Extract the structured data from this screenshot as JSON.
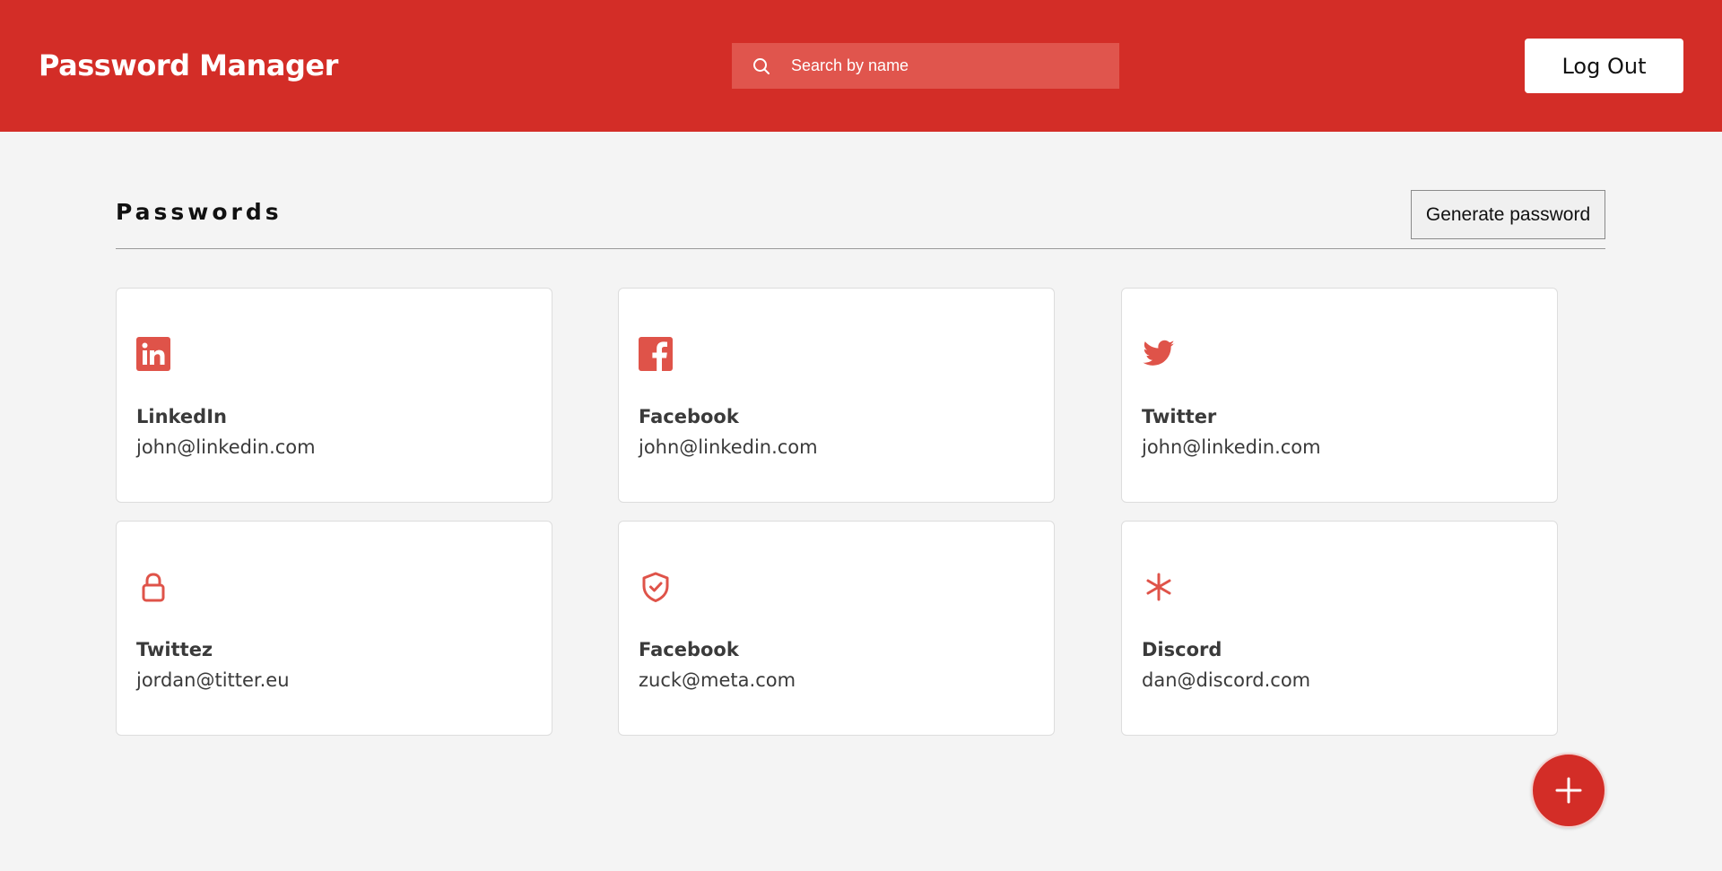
{
  "header": {
    "title": "Password Manager",
    "search_placeholder": "Search by name",
    "logout_label": "Log Out"
  },
  "section": {
    "title": "Passwords",
    "generate_label": "Generate password"
  },
  "cards": [
    {
      "name": "LinkedIn",
      "email": "john@linkedin.com",
      "icon": "linkedin-icon"
    },
    {
      "name": "Facebook",
      "email": "john@linkedin.com",
      "icon": "facebook-icon"
    },
    {
      "name": "Twitter",
      "email": "john@linkedin.com",
      "icon": "twitter-icon"
    },
    {
      "name": "Twittez",
      "email": "jordan@titter.eu",
      "icon": "lock-icon"
    },
    {
      "name": "Facebook",
      "email": "zuck@meta.com",
      "icon": "shield-check-icon"
    },
    {
      "name": "Discord",
      "email": "dan@discord.com",
      "icon": "asterisk-icon"
    }
  ],
  "colors": {
    "brand": "#d32d27",
    "search_bg": "#e0554d",
    "icon": "#df5349",
    "page_bg": "#f4f4f4"
  },
  "fab": {
    "icon": "plus-icon"
  }
}
